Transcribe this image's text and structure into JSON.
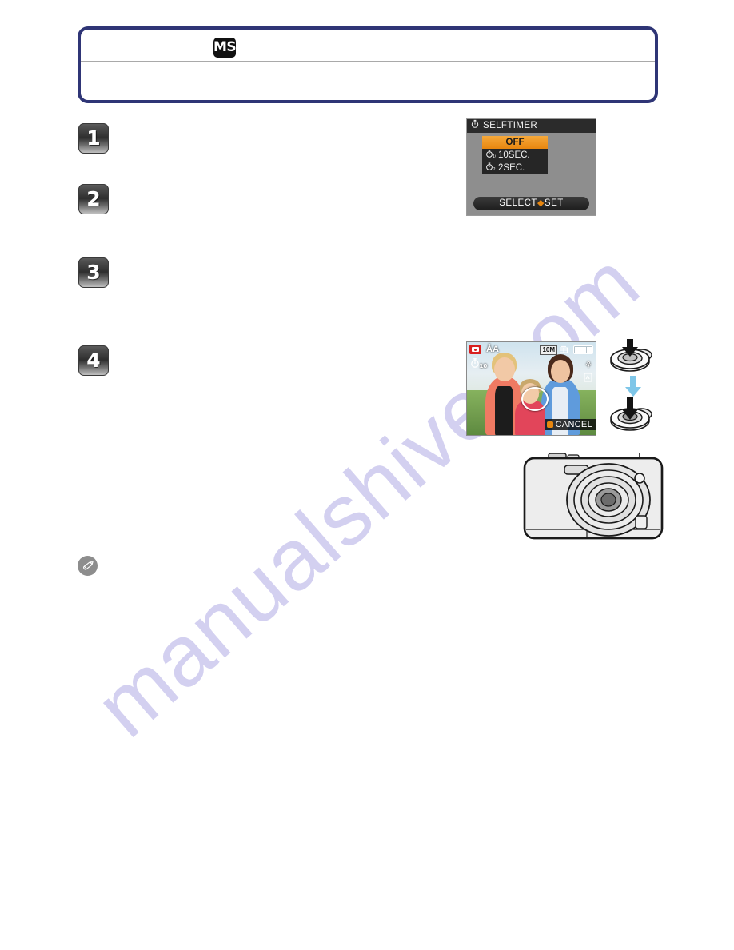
{
  "page": {
    "watermark": "manualshive.com",
    "background_color": "#ffffff"
  },
  "callout": {
    "border_color": "#2f3576",
    "badge_label": "MS",
    "badge_name": "ms-mode-icon",
    "heading_text": "",
    "body_text": ""
  },
  "steps": [
    {
      "number": "1",
      "text": ""
    },
    {
      "number": "2",
      "text": ""
    },
    {
      "number": "3",
      "text": ""
    },
    {
      "number": "4",
      "text": ""
    }
  ],
  "note": {
    "icon": "pencil-note-icon",
    "text": ""
  },
  "selftimer_menu": {
    "title": "SELFTIMER",
    "title_icon": "selftimer-icon",
    "options": [
      {
        "icon": "",
        "label": "OFF",
        "selected": true
      },
      {
        "icon": "selftimer-10sec-icon",
        "label": "10SEC.",
        "selected": false
      },
      {
        "icon": "selftimer-2sec-icon",
        "label": "2SEC.",
        "selected": false
      }
    ],
    "footer_select": "SELECT",
    "footer_set": "SET",
    "highlight_color": "#e8860f"
  },
  "live_view": {
    "record_icon": "record-mode-icon",
    "flash_label": "ÅA",
    "selftimer_indicator": "selftimer-10sec-icon",
    "resolution_label": "10M",
    "quality_icon": "fine-quality-icon",
    "battery_icon": "battery-full-icon",
    "af_icon_1": "af-mode-icon",
    "af_icon_2": "stabilizer-icon",
    "face_detect_icon": "face-detect-frame-icon",
    "cancel_label": "CANCEL"
  },
  "shutter_diagram": {
    "step_half_press": "shutter-half-press-icon",
    "arrow": "down-arrow-icon",
    "step_full_press": "shutter-full-press-icon",
    "arrow_color": "#7ec6e8"
  },
  "camera_illustration": {
    "name": "camera-front-view",
    "callout_target": "selftimer-lamp"
  }
}
